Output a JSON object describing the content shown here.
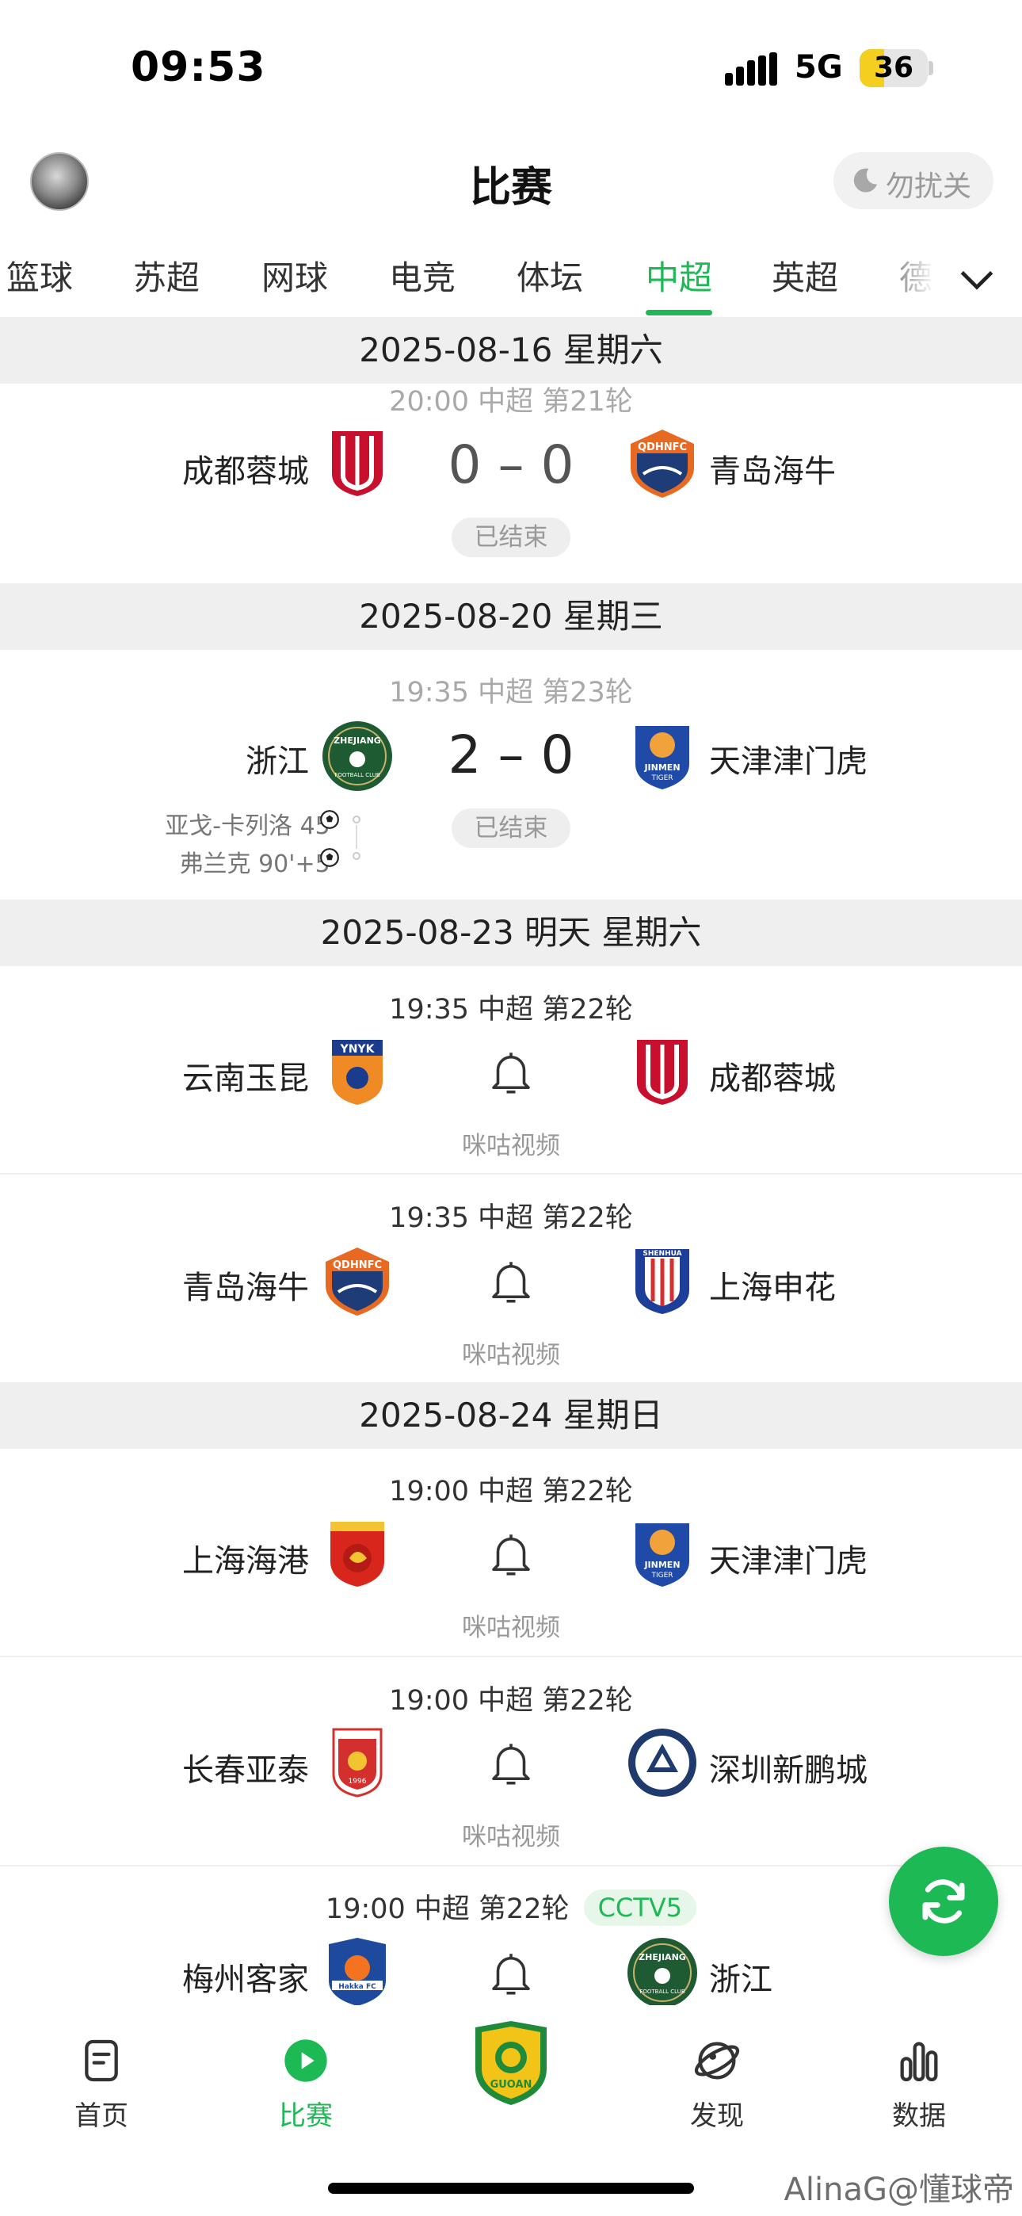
{
  "status_bar": {
    "time": "09:53",
    "network": "5G",
    "battery": "36",
    "battery_level": 0.36
  },
  "header": {
    "title": "比赛",
    "dnd_label": "勿扰关"
  },
  "tabs": {
    "items": [
      "篮球",
      "苏超",
      "网球",
      "电竞",
      "体坛",
      "中超",
      "英超",
      "德"
    ],
    "active": "中超"
  },
  "dates": {
    "d0816": "2025-08-16 星期六",
    "d0820": "2025-08-20 星期三",
    "d0823": "2025-08-23 明天 星期六",
    "d0824": "2025-08-24 星期日"
  },
  "matches": {
    "m1": {
      "meta": "20:00 中超 第21轮",
      "home": "成都蓉城",
      "away": "青岛海牛",
      "score": "0 – 0",
      "status": "已结束"
    },
    "m2": {
      "meta": "19:35 中超 第23轮",
      "home": "浙江",
      "away": "天津津门虎",
      "score": "2 – 0",
      "status": "已结束",
      "scorers": [
        "亚戈-卡列洛 45'",
        "弗兰克 90'+5'"
      ]
    },
    "m3": {
      "meta": "19:35 中超 第22轮",
      "home": "云南玉昆",
      "away": "成都蓉城",
      "broadcast": "咪咕视频"
    },
    "m4": {
      "meta": "19:35 中超 第22轮",
      "home": "青岛海牛",
      "away": "上海申花",
      "broadcast": "咪咕视频"
    },
    "m5": {
      "meta": "19:00 中超 第22轮",
      "home": "上海海港",
      "away": "天津津门虎",
      "broadcast": "咪咕视频"
    },
    "m6": {
      "meta": "19:00 中超 第22轮",
      "home": "长春亚泰",
      "away": "深圳新鹏城",
      "broadcast": "咪咕视频"
    },
    "m7": {
      "meta": "19:00 中超 第22轮",
      "channel": "CCTV5",
      "home": "梅州客家",
      "away": "浙江"
    }
  },
  "bottom_nav": {
    "home": "首页",
    "matches": "比赛",
    "discover": "发现",
    "data": "数据",
    "center_logo": "GUOAN"
  },
  "watermark": "AlinaG@懂球帝",
  "colors": {
    "accent": "#1db954"
  }
}
